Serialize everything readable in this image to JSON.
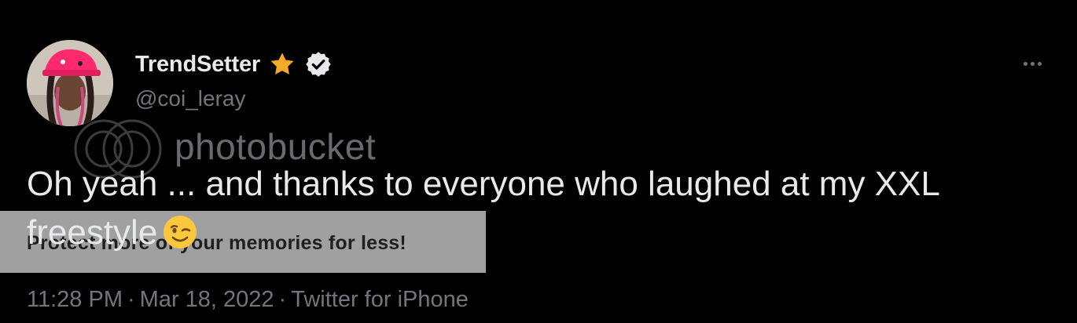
{
  "author": {
    "display_name": "TrendSetter",
    "handle": "@coi_leray",
    "star_icon": "star-icon",
    "verified_icon": "verified-badge-icon"
  },
  "tweet": {
    "text": "Oh yeah ... and thanks to everyone who laughed at my XXL freestyle",
    "emoji": "winking-face-emoji"
  },
  "meta": {
    "time": "11:28 PM",
    "separator": "·",
    "date": "Mar 18, 2022",
    "source": "Twitter for iPhone"
  },
  "overlay": {
    "watermark_text": "photobucket",
    "banner_text": "Protect more of your memories for less!"
  },
  "colors": {
    "background": "#000000",
    "primary_text": "#e7e9ea",
    "secondary_text": "#71767b",
    "star": "#f7a928",
    "badge": "#e7e9ea"
  }
}
